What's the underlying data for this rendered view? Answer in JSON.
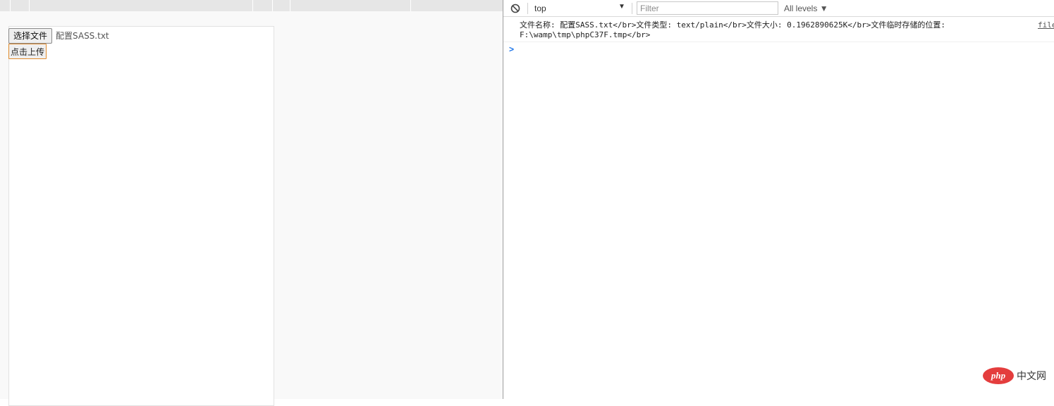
{
  "page": {
    "choose_button_label": "选择文件",
    "selected_file_name": "配置SASS.txt",
    "upload_button_label": "点击上传"
  },
  "console": {
    "context_label": "top",
    "filter_placeholder": "Filter",
    "levels_label": "All levels",
    "log_line_1": "文件名称: 配置SASS.txt</br>文件类型: text/plain</br>文件大小: 0.1962890625K</br>文件临时存储的位置:",
    "log_line_2": "F:\\wamp\\tmp\\phpC37F.tmp</br>",
    "log_source": "file",
    "prompt_symbol": ">"
  },
  "watermark": {
    "logo_text": "php",
    "site_text": "中文网"
  },
  "colors": {
    "focus_border": "#e08a2c",
    "prompt": "#1a73e8",
    "logo": "#e43d3d"
  },
  "icons": {
    "clear": "block-icon",
    "dropdown": "triangle-down-icon"
  }
}
